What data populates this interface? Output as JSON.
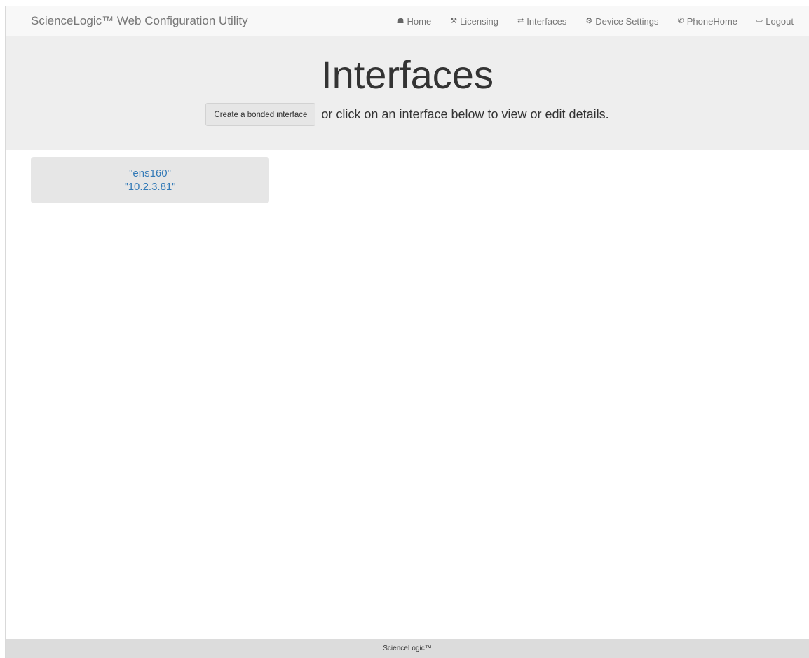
{
  "brand": "ScienceLogic™ Web Configuration Utility",
  "nav": [
    {
      "icon": "home-icon",
      "glyph": "☗",
      "label": "Home"
    },
    {
      "icon": "gavel-icon",
      "glyph": "⚒",
      "label": "Licensing"
    },
    {
      "icon": "swap-arrows-icon",
      "glyph": "⇄",
      "label": "Interfaces"
    },
    {
      "icon": "gear-icon",
      "glyph": "⚙",
      "label": "Device Settings"
    },
    {
      "icon": "phone-icon",
      "glyph": "✆",
      "label": "PhoneHome"
    },
    {
      "icon": "logout-icon",
      "glyph": "⇨",
      "label": "Logout"
    }
  ],
  "header": {
    "title": "Interfaces",
    "bond_button_label": "Create a bonded interface",
    "instructions": "or click on an interface below to view or edit details."
  },
  "interfaces": [
    {
      "name": "\"ens160\"",
      "ip": "\"10.2.3.81\""
    }
  ],
  "footer": {
    "text": "ScienceLogic™"
  },
  "colors": {
    "link": "#337ab7",
    "navbar_bg": "#f8f8f8",
    "jumbotron_bg": "#eeeeee",
    "footer_bg": "#dcdcdc"
  }
}
